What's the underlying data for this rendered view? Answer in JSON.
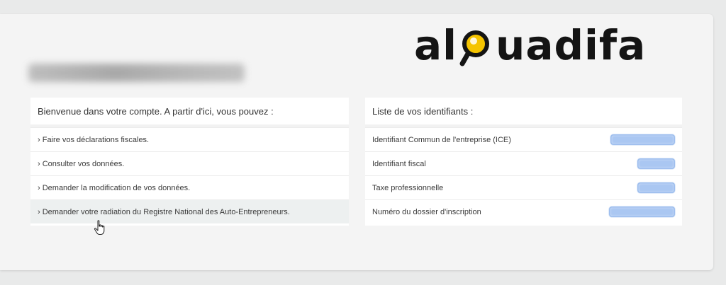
{
  "brand": {
    "logo_left": "al",
    "logo_right": "uadifa",
    "accent_color": "#f5c400"
  },
  "welcome_panel": {
    "title": "Bienvenue dans votre compte. A partir d'ici, vous pouvez :",
    "items": [
      {
        "label": "› Faire vos déclarations fiscales."
      },
      {
        "label": "› Consulter vos données."
      },
      {
        "label": "› Demander la modification de vos données."
      },
      {
        "label": "› Demander votre radiation du Registre National des Auto-Entrepreneurs."
      }
    ]
  },
  "identifiers_panel": {
    "title": "Liste de vos identifiants :",
    "items": [
      {
        "label": "Identifiant Commun de l'entreprise (ICE)"
      },
      {
        "label": "Identifiant fiscal"
      },
      {
        "label": "Taxe professionnelle"
      },
      {
        "label": "Numéro du dossier d'inscription"
      }
    ]
  },
  "cursor": {
    "icon": "hand-pointer-icon"
  }
}
